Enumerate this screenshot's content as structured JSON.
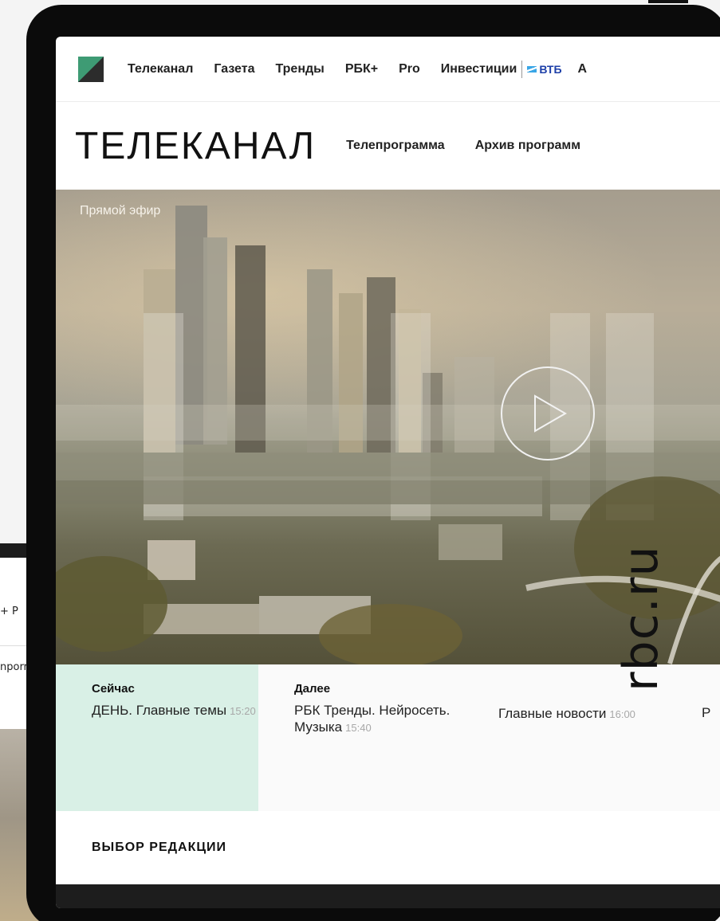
{
  "background_device": {
    "nav_fragment": "+ Р",
    "header_fragment": "nporr"
  },
  "nav": {
    "items": [
      "Телеканал",
      "Газета",
      "Тренды",
      "РБК+",
      "Pro",
      "Инвестиции"
    ],
    "partner": "ВТБ",
    "overflow": "А"
  },
  "header": {
    "title": "ТЕЛЕКАНАЛ",
    "links": [
      "Телепрограмма",
      "Архив программ"
    ]
  },
  "player": {
    "live_label": "Прямой эфир",
    "play_icon": "play-icon"
  },
  "schedule": {
    "now_label": "Сейчас",
    "now_title": "ДЕНЬ. Главные темы",
    "now_time": "15:20",
    "next_label": "Далее",
    "next_items": [
      {
        "title": "РБК Тренды. Нейросеть. Музыка",
        "time": "15:40"
      },
      {
        "title": "Главные новости",
        "time": "16:00"
      }
    ],
    "overflow": "Р"
  },
  "editors": {
    "title": "ВЫБОР РЕДАКЦИИ"
  },
  "watermark": "rbc.ru",
  "colors": {
    "accent_green": "#d9f0e6",
    "logo_green": "#3e9b74",
    "vtb_blue": "#1d3fa8"
  }
}
